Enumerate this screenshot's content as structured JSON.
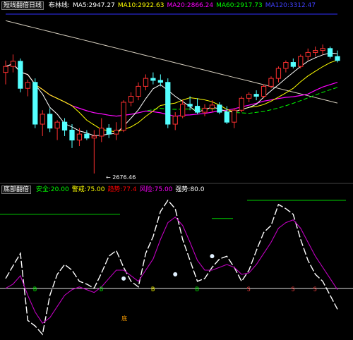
{
  "top_legend": {
    "panel_name": "短线翻倍日线",
    "items": [
      {
        "text": "布林线:",
        "color": "#ffffff"
      },
      {
        "text": "MA5:2947.27",
        "color": "#ffffff"
      },
      {
        "text": "MA10:2922.63",
        "color": "#ffff00"
      },
      {
        "text": "MA20:2866.24",
        "color": "#ff00ff"
      },
      {
        "text": "MA60:2917.73",
        "color": "#00ff00"
      },
      {
        "text": "MA120:3312.47",
        "color": "#4040ff"
      }
    ]
  },
  "bottom_legend": {
    "panel_name": "底部翻倍",
    "items": [
      {
        "text": "安全:20.00",
        "color": "#00ff00"
      },
      {
        "text": "警戒:75.00",
        "color": "#ffff00"
      },
      {
        "text": "趋势:77.4",
        "color": "#ff0000"
      },
      {
        "text": "风险:75.00",
        "color": "#ff00ff"
      },
      {
        "text": "强势:80.0",
        "color": "#ffffff"
      }
    ]
  },
  "low_marker": "← 2676.46",
  "signal_markers": {
    "buy_glyph": "B",
    "sell_glyph": "S",
    "bottom_glyph": "底"
  },
  "colors": {
    "background": "#000000",
    "up_candle": "#ff3030",
    "down_candle": "#54ffff",
    "ma5": "#ffffff",
    "ma10": "#ffff00",
    "ma20": "#ff00ff",
    "ma60": "#00ff00",
    "ma120": "#3030ff",
    "long_trend": "#d8d0c0",
    "signal_line": "#ffffff",
    "signal_slow": "#c000c0",
    "threshold_green": "#00d000",
    "baseline": "#e0e0e0"
  },
  "chart_data": [
    {
      "type": "candlestick",
      "title": "",
      "candles": [
        [
          2930,
          2960,
          2900,
          2945
        ],
        [
          2945,
          2975,
          2930,
          2958
        ],
        [
          2958,
          2965,
          2880,
          2890
        ],
        [
          2890,
          2912,
          2870,
          2905
        ],
        [
          2905,
          2915,
          2790,
          2800
        ],
        [
          2800,
          2835,
          2770,
          2825
        ],
        [
          2825,
          2840,
          2780,
          2790
        ],
        [
          2790,
          2810,
          2760,
          2805
        ],
        [
          2805,
          2815,
          2770,
          2785
        ],
        [
          2785,
          2800,
          2740,
          2760
        ],
        [
          2760,
          2790,
          2745,
          2775
        ],
        [
          2775,
          2785,
          2760,
          2765
        ],
        [
          2765,
          2785,
          2676,
          2770
        ],
        [
          2770,
          2815,
          2755,
          2790
        ],
        [
          2790,
          2800,
          2765,
          2775
        ],
        [
          2775,
          2805,
          2760,
          2785
        ],
        [
          2785,
          2860,
          2780,
          2855
        ],
        [
          2855,
          2880,
          2845,
          2870
        ],
        [
          2870,
          2905,
          2860,
          2895
        ],
        [
          2895,
          2925,
          2885,
          2915
        ],
        [
          2915,
          2930,
          2900,
          2910
        ],
        [
          2910,
          2925,
          2895,
          2905
        ],
        [
          2905,
          2915,
          2790,
          2800
        ],
        [
          2800,
          2830,
          2785,
          2820
        ],
        [
          2820,
          2860,
          2815,
          2850
        ],
        [
          2850,
          2870,
          2835,
          2845
        ],
        [
          2845,
          2865,
          2825,
          2830
        ],
        [
          2830,
          2850,
          2820,
          2840
        ],
        [
          2840,
          2860,
          2830,
          2848
        ],
        [
          2848,
          2855,
          2825,
          2830
        ],
        [
          2830,
          2845,
          2800,
          2805
        ],
        [
          2805,
          2840,
          2790,
          2835
        ],
        [
          2835,
          2870,
          2830,
          2865
        ],
        [
          2865,
          2880,
          2855,
          2875
        ],
        [
          2875,
          2885,
          2860,
          2870
        ],
        [
          2870,
          2900,
          2865,
          2895
        ],
        [
          2895,
          2920,
          2890,
          2915
        ],
        [
          2915,
          2945,
          2905,
          2940
        ],
        [
          2940,
          2960,
          2930,
          2955
        ],
        [
          2955,
          2965,
          2940,
          2945
        ],
        [
          2945,
          2975,
          2940,
          2970
        ],
        [
          2970,
          2990,
          2960,
          2980
        ],
        [
          2980,
          2995,
          2970,
          2985
        ],
        [
          2985,
          3000,
          2975,
          2990
        ],
        [
          2990,
          2995,
          2965,
          2970
        ],
        [
          2970,
          2985,
          2955,
          2960
        ]
      ],
      "ylim": [
        2660,
        3080
      ]
    },
    {
      "type": "line",
      "title": "",
      "series": [
        {
          "name": "",
          "role": "signal",
          "values": [
            42,
            51,
            60,
            12,
            8,
            2,
            30,
            45,
            52,
            48,
            40,
            38,
            35,
            46,
            58,
            62,
            50,
            40,
            36,
            60,
            72,
            90,
            98,
            92,
            70,
            55,
            40,
            42,
            50,
            56,
            58,
            50,
            40,
            48,
            62,
            75,
            80,
            95,
            92,
            88,
            70,
            55,
            45,
            40,
            30,
            20
          ]
        },
        {
          "name": "",
          "role": "slow",
          "values": [
            35,
            38,
            44,
            30,
            18,
            10,
            14,
            22,
            30,
            34,
            36,
            34,
            32,
            36,
            42,
            48,
            48,
            44,
            40,
            48,
            56,
            70,
            82,
            86,
            80,
            68,
            55,
            48,
            48,
            50,
            52,
            50,
            45,
            46,
            52,
            60,
            68,
            78,
            82,
            84,
            78,
            68,
            58,
            50,
            42,
            34
          ]
        }
      ],
      "ylim": [
        0,
        100
      ]
    }
  ]
}
